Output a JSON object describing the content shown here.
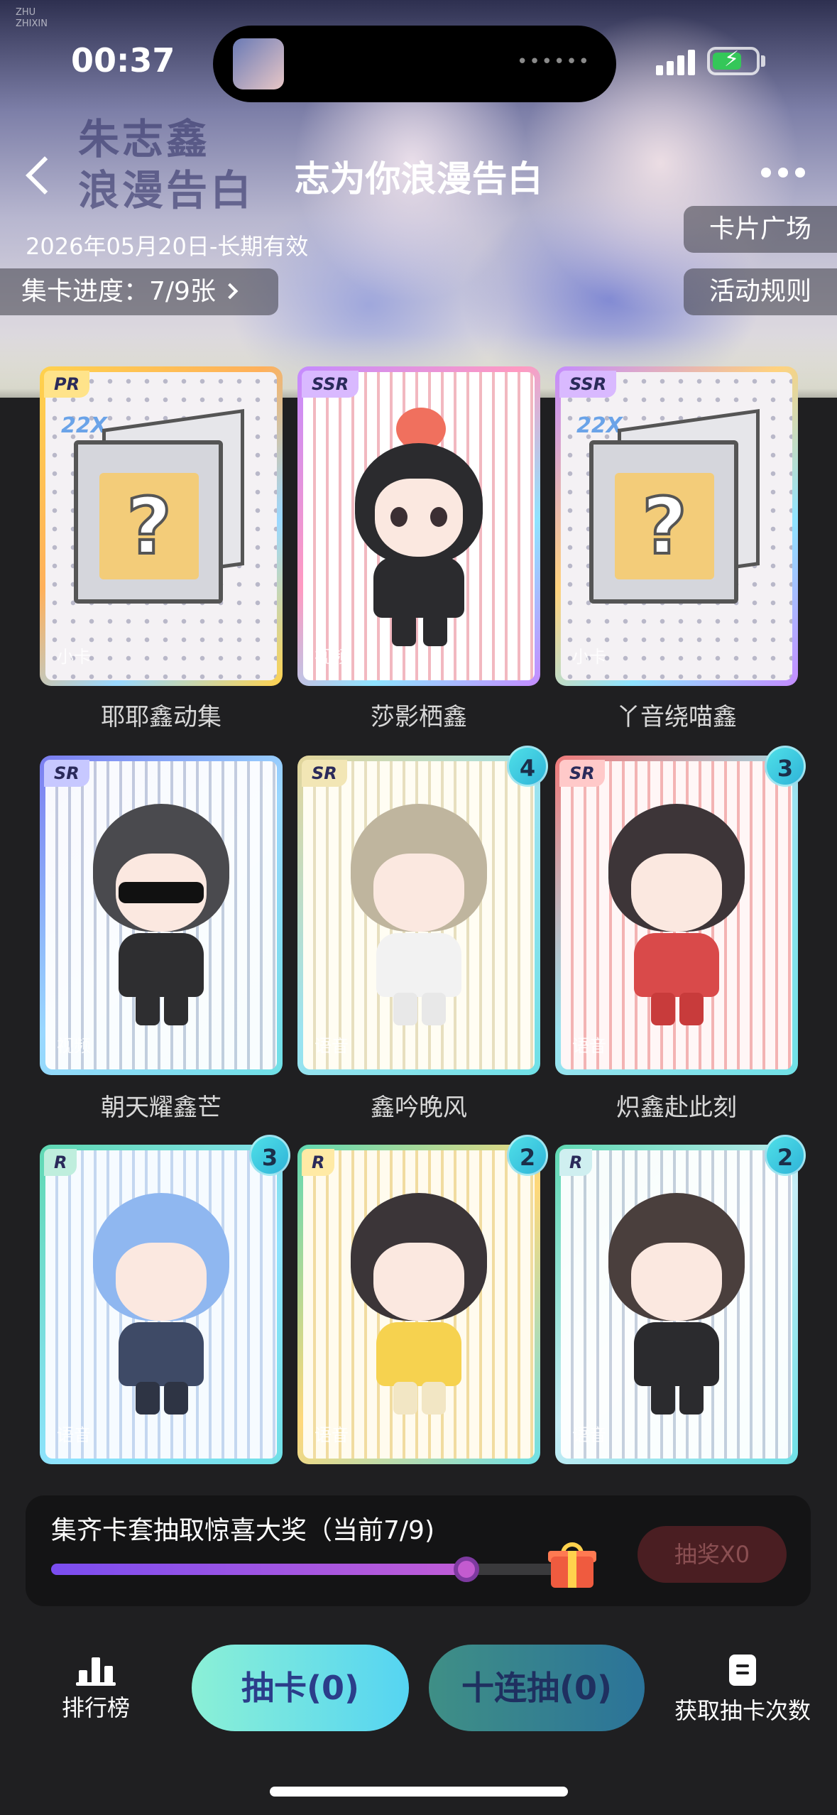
{
  "status": {
    "time": "00:37"
  },
  "hero": {
    "title_art": "朱志鑫\n浪漫告白",
    "small_logo": "ZHU\nZHIXIN"
  },
  "nav": {
    "title": "志为你浪漫告白"
  },
  "event": {
    "date": "2026年05月20日-长期有效",
    "progress": "集卡进度：7/9张"
  },
  "side_buttons": {
    "square": "卡片广场",
    "rules": "活动规则"
  },
  "cards": [
    {
      "name": "耶耶鑫动集",
      "rarity": "PR",
      "count": "",
      "locked": true,
      "watermark": "小卡"
    },
    {
      "name": "莎影栖鑫",
      "rarity": "SSR",
      "count": "",
      "locked": false,
      "watermark": "视频"
    },
    {
      "name": "丫音绕喵鑫",
      "rarity": "SSR",
      "count": "",
      "locked": true,
      "watermark": "小卡"
    },
    {
      "name": "朝天耀鑫芒",
      "rarity": "SR",
      "count": "",
      "locked": false,
      "watermark": "视频"
    },
    {
      "name": "鑫吟晚风",
      "rarity": "SR",
      "count": "4",
      "locked": false,
      "watermark": "语音"
    },
    {
      "name": "炽鑫赴此刻",
      "rarity": "SR",
      "count": "3",
      "locked": false,
      "watermark": "语音"
    },
    {
      "name": "",
      "rarity": "R",
      "count": "3",
      "locked": false,
      "watermark": "语音"
    },
    {
      "name": "",
      "rarity": "R",
      "count": "2",
      "locked": false,
      "watermark": "语音"
    },
    {
      "name": "",
      "rarity": "R",
      "count": "2",
      "locked": false,
      "watermark": "语音"
    }
  ],
  "box_tag": "22X",
  "reward": {
    "text": "集齐卡套抽取惊喜大奖（当前7/9)",
    "progress": 0.78,
    "button": "抽奖X0"
  },
  "bottom": {
    "rank": "排行榜",
    "draw": "抽卡(0)",
    "ten_draw": "十连抽(0)",
    "get_chances": "获取抽卡次数"
  },
  "colors": {
    "accent_cyan": "#55d4f2",
    "accent_purple": "#7a4df0",
    "background": "#1f1f21"
  }
}
